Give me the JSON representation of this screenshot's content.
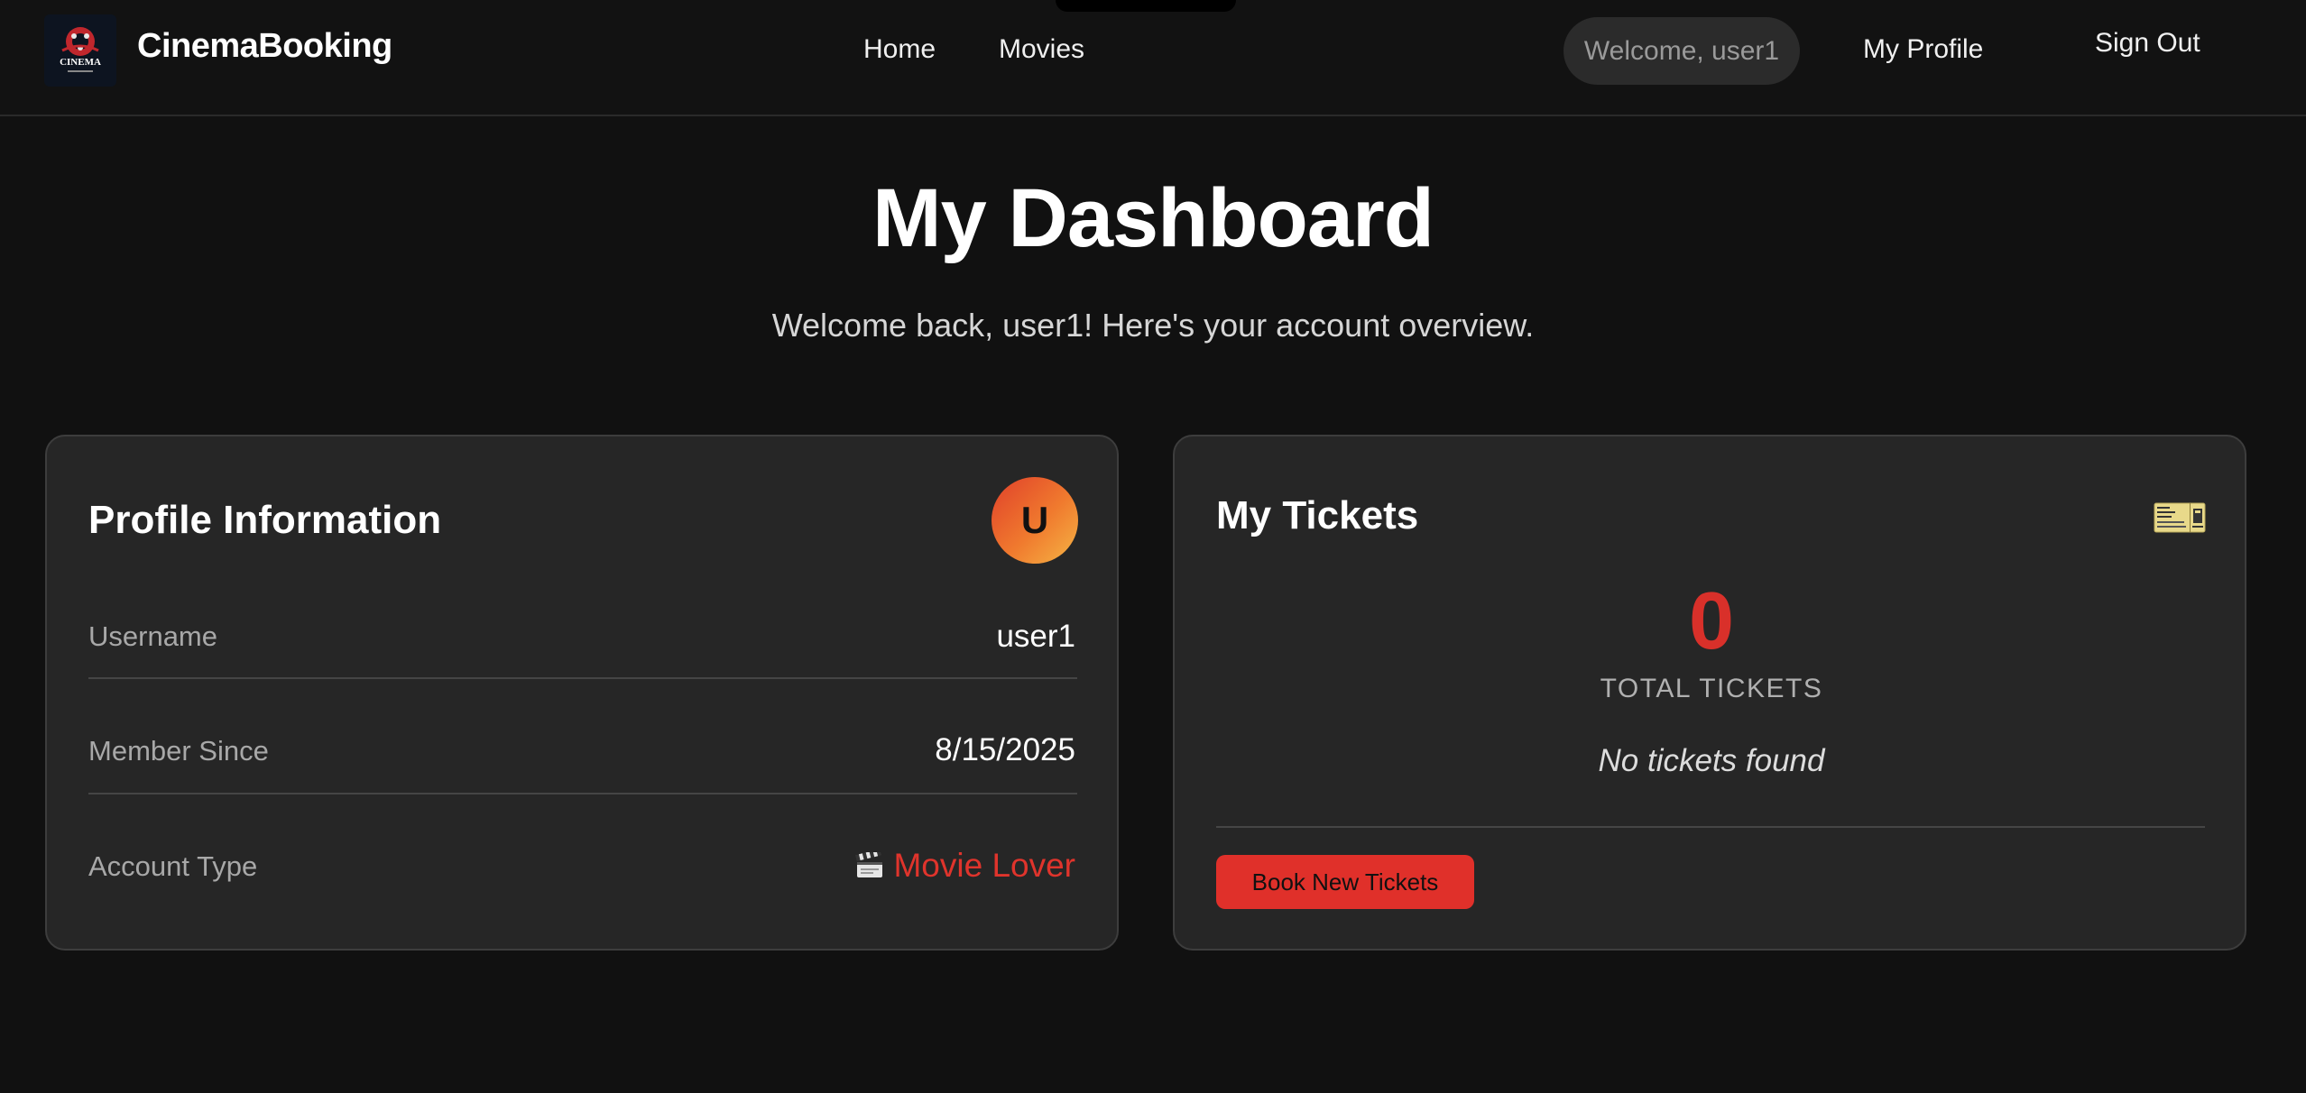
{
  "header": {
    "brand": "CinemaBooking",
    "logo_text": "CINEMA",
    "nav": {
      "home": "Home",
      "movies": "Movies"
    },
    "welcome": "Welcome, user1",
    "my_profile": "My Profile",
    "sign_out": "Sign Out"
  },
  "page": {
    "title": "My Dashboard",
    "subtitle": "Welcome back, user1! Here's your account overview."
  },
  "profile": {
    "title": "Profile Information",
    "avatar_initial": "U",
    "rows": [
      {
        "label": "Username",
        "value": "user1"
      },
      {
        "label": "Member Since",
        "value": "8/15/2025"
      },
      {
        "label": "Account Type",
        "value": "Movie Lover"
      }
    ],
    "account_type_icon": "clapperboard-icon"
  },
  "tickets": {
    "title": "My Tickets",
    "icon": "ticket-icon",
    "count": "0",
    "caption": "TOTAL TICKETS",
    "empty": "No tickets found",
    "book_button": "Book New Tickets"
  },
  "colors": {
    "background": "#111111",
    "card": "#262626",
    "accent_red": "#e0302a",
    "avatar_gradient_start": "#e0402a",
    "avatar_gradient_end": "#f5b545"
  }
}
